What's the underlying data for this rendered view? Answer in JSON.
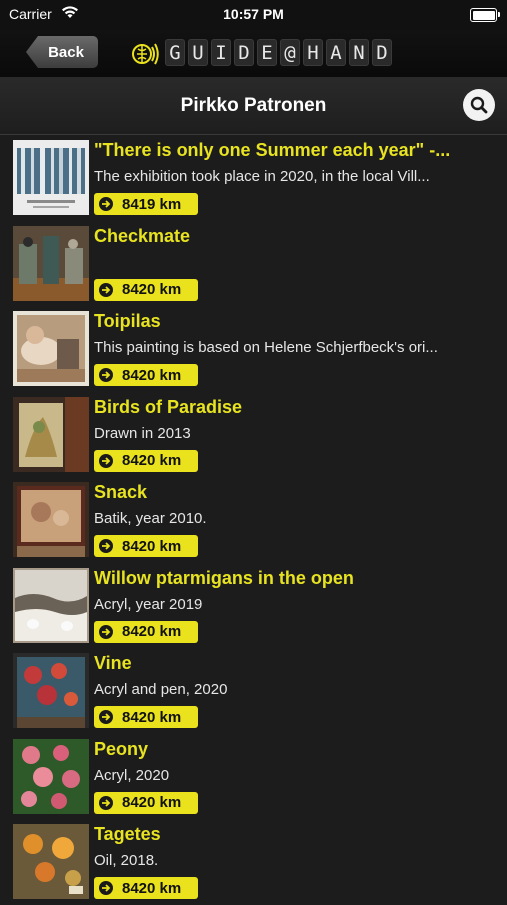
{
  "status": {
    "carrier": "Carrier",
    "time": "10:57 PM"
  },
  "nav": {
    "back_label": "Back",
    "brand_letters": [
      "G",
      "U",
      "I",
      "D",
      "E",
      "@",
      "H",
      "A",
      "N",
      "D"
    ],
    "title": "Pirkko Patronen"
  },
  "items": [
    {
      "title": "\"There is only one Summer each year\" -...",
      "desc": "The  exhibition took place in 2020, in the local Vill...",
      "distance": "8419 km"
    },
    {
      "title": "Checkmate",
      "desc": "",
      "distance": "8420 km"
    },
    {
      "title": "Toipilas",
      "desc": "This painting is based on Helene Schjerfbeck's ori...",
      "distance": "8420 km"
    },
    {
      "title": "Birds of Paradise",
      "desc": "Drawn in 2013",
      "distance": "8420 km"
    },
    {
      "title": "Snack",
      "desc": "Batik, year 2010.",
      "distance": "8420 km"
    },
    {
      "title": "Willow ptarmigans in the open",
      "desc": "Acryl, year 2019",
      "distance": "8420 km"
    },
    {
      "title": "Vine",
      "desc": "Acryl and pen, 2020",
      "distance": "8420 km"
    },
    {
      "title": "Peony",
      "desc": "Acryl, 2020",
      "distance": "8420 km"
    },
    {
      "title": "Tagetes",
      "desc": "Oil, 2018.",
      "distance": "8420 km"
    }
  ],
  "colors": {
    "accent": "#e9e21c",
    "background": "#1c1c1c"
  }
}
